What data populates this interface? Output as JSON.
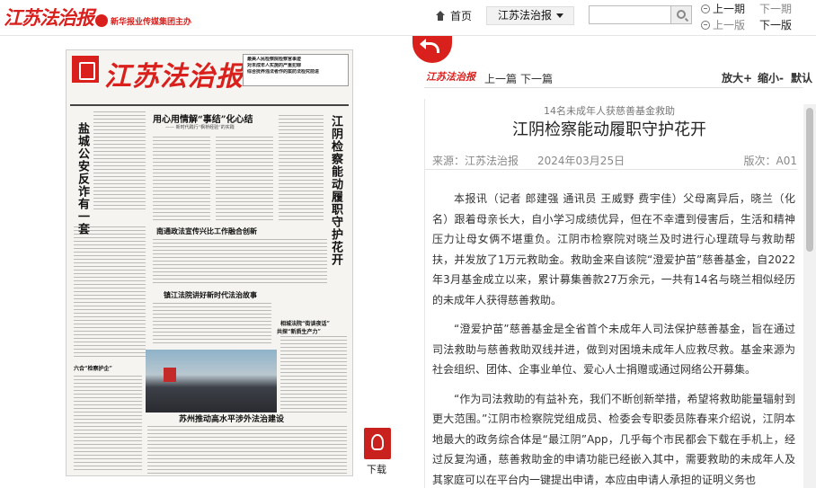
{
  "header": {
    "site_logo": "江苏法治报",
    "group_logo": "新华报业传媒集团主办",
    "home_label": "首页",
    "paper_select": "江苏法治报",
    "search_placeholder": "",
    "prev_issue": "上一期",
    "prev_page": "上一版",
    "next_issue": "下一期",
    "next_page": "下一版"
  },
  "page_scan": {
    "masthead": "江苏法治报",
    "top_box": [
      "最美人民检察院检察官事迹",
      "对未成年人实施的严重犯罪",
      "综合抚养违法者作的案防法检究前进"
    ],
    "headlines": {
      "main": "用心用情解“事结”化心结",
      "main_sub": "—— 新时代践行“枫桥经验”的实践",
      "left_vertical": "盐城公安反诈有一套",
      "right_vertical": "江阴检察能动履职守护花开",
      "h2": "南通政法宣传兴比工作融合创新",
      "h3": "镇江法院讲好新时代法治故事",
      "h4a": "相城法院“街谈夜话”",
      "h4b": "共探“新质生产力”",
      "h5": "六合“检察护企”",
      "bottom": "苏州推动高水平涉外法治建设"
    },
    "download_label": "下载",
    "pdf_icon": "pdf-icon"
  },
  "article": {
    "toolbar": {
      "logo": "江苏法治报",
      "prev": "上一篇",
      "next": "下一篇",
      "zoom_in": "放大+",
      "zoom_out": "缩小-",
      "reset": "默认"
    },
    "kicker": "14名未成年人获慈善基金救助",
    "title": "江阴检察能动履职守护花开",
    "source": "来源：江苏法治报",
    "date": "2024年03月25日",
    "edition": "版次：A01",
    "paragraphs": [
      "本报讯（记者 郎建强 通讯员 王威野 费宇佳）父母离异后，晓兰（化名）跟着母亲长大，自小学习成绩优异，但在不幸遭到侵害后，生活和精神压力让母女俩不堪重负。江阴市检察院对晓兰及时进行心理疏导与救助帮扶，并发放了1万元救助金。救助金来自该院“澄爱护苗”慈善基金，自2022年3月基金成立以来，累计募集善款27万余元，一共有14名与晓兰相似经历的未成年人获得慈善救助。",
      "“澄爱护苗”慈善基金是全省首个未成年人司法保护慈善基金，旨在通过司法救助与慈善救助双线并进，做到对困境未成年人应救尽救。基金来源为社会组织、团体、企事业单位、爱心人士捐赠或通过网络公开募集。",
      "“作为司法救助的有益补充，我们不断创新举措，希望将救助能量辐射到更大范围。”江阴市检察院党组成员、检委会专职委员陈春来介绍说，江阴本地最大的政务综合体是“最江阴”App，几乎每个市民都会下载在手机上，经过反复沟通，慈善救助金的申请功能已经嵌入其中，需要救助的未成年人及其家庭可以在平台内一键提出申请，本应由申请人承担的证明义务也"
    ]
  }
}
